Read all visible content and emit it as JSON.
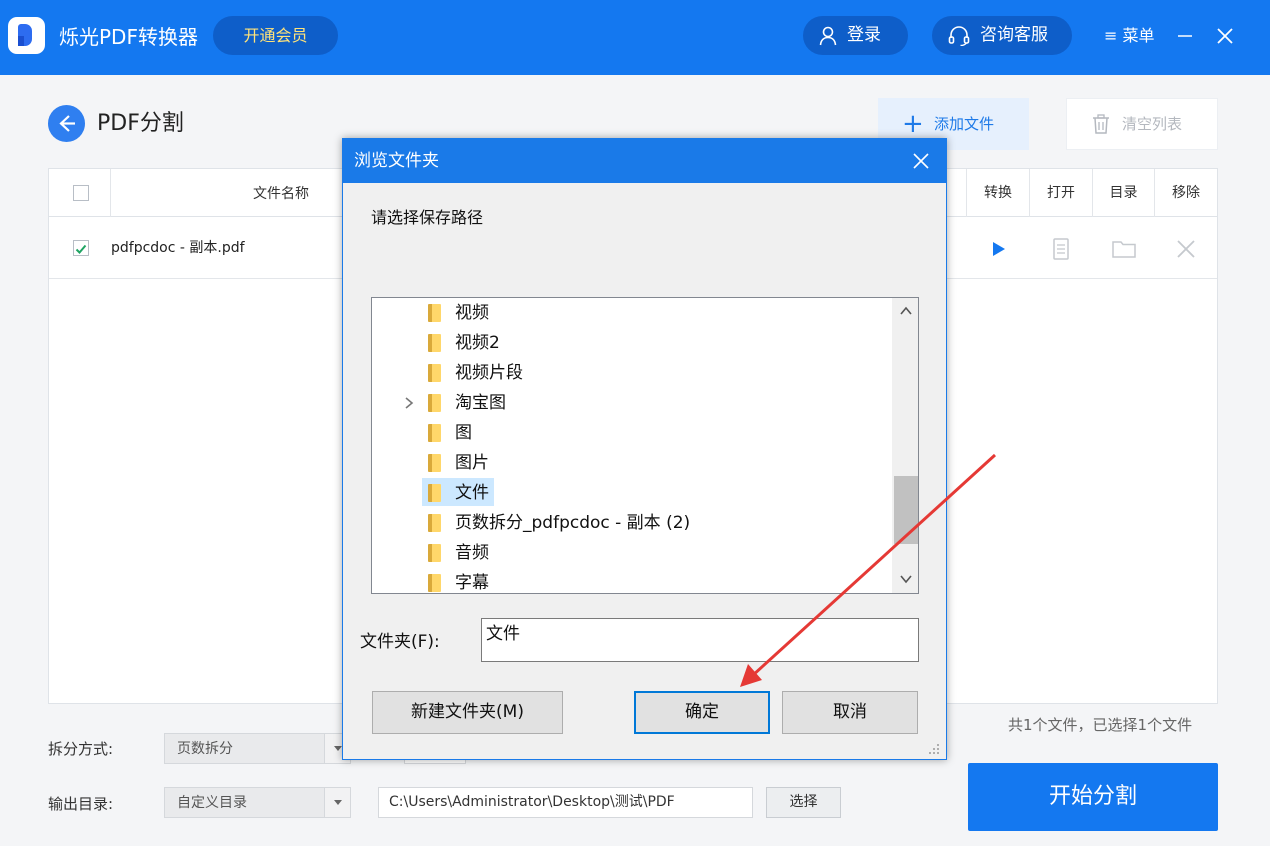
{
  "app": {
    "title": "烁光PDF转换器",
    "vip_label": "开通会员",
    "login_label": "登录",
    "service_label": "咨询客服",
    "menu_label": "≡ 菜单",
    "brand_color": "#1478f0"
  },
  "page": {
    "title": "PDF分割",
    "add_file_label": "添加文件",
    "clear_list_label": "清空列表"
  },
  "table": {
    "headers": {
      "name": "文件名称",
      "convert": "转换",
      "open": "打开",
      "directory": "目录",
      "remove": "移除"
    },
    "rows": [
      {
        "name": "pdfpcdoc - 副本.pdf",
        "checked": true
      }
    ],
    "summary": "共1个文件，已选择1个文件"
  },
  "form": {
    "split_mode_label": "拆分方式:",
    "split_mode_value": "页数拆分",
    "output_dir_label": "输出目录:",
    "output_dir_mode": "自定义目录",
    "output_path": "C:\\Users\\Administrator\\Desktop\\测试\\PDF",
    "choose_label": "选择",
    "start_label": "开始分割"
  },
  "dialog": {
    "title": "浏览文件夹",
    "prompt": "请选择保存路径",
    "folders": [
      {
        "name": "视频"
      },
      {
        "name": "视频2"
      },
      {
        "name": "视频片段"
      },
      {
        "name": "淘宝图",
        "expandable": true
      },
      {
        "name": "图"
      },
      {
        "name": "图片"
      },
      {
        "name": "文件",
        "selected": true
      },
      {
        "name": "页数拆分_pdfpcdoc - 副本 (2)"
      },
      {
        "name": "音频"
      },
      {
        "name": "字幕"
      }
    ],
    "folder_label": "文件夹(F):",
    "folder_value": "文件",
    "new_folder_label": "新建文件夹(M)",
    "ok_label": "确定",
    "cancel_label": "取消"
  },
  "annotation": {
    "arrow_color": "#e53935"
  }
}
